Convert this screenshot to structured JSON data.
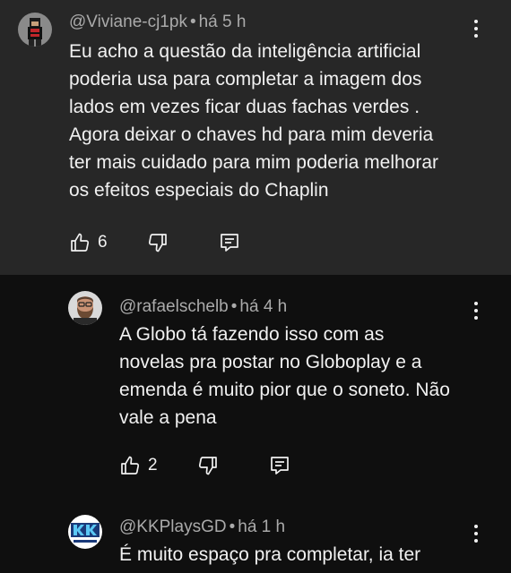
{
  "comments": [
    {
      "author": "@Viviane-cj1pk",
      "separator": "•",
      "time": "há 5 h",
      "text": "Eu acho a questão da inteligência artificial\npoderia usa para completar a imagem dos\nlados em vezes ficar duas fachas verdes .\nAgora deixar o chaves hd para mim deveria\nter mais cuidado para mim poderia melhorar\nos efeitos especiais do Chaplin",
      "likes": "6",
      "avatar_icon": "pixel-character-avatar"
    },
    {
      "author": "@rafaelschelb",
      "separator": "•",
      "time": "há 4 h",
      "text": "A Globo tá fazendo isso com as\nnovelas pra postar no Globoplay e a\nemenda é muito pior que o soneto. Não\nvale a pena",
      "likes": "2",
      "avatar_icon": "bearded-man-avatar"
    },
    {
      "author": "@KKPlaysGD",
      "separator": "•",
      "time": "há 1 h",
      "text": "É muito espaço pra completar, ia ter",
      "avatar_icon": "kk-logo-avatar"
    }
  ],
  "colors": {
    "highlight_bg": "#272727",
    "page_bg": "#0f0f0f",
    "text": "#f1f1f1",
    "meta": "#aaaaaa"
  },
  "icons": [
    "like-icon",
    "dislike-icon",
    "reply-icon",
    "more-options-icon"
  ]
}
